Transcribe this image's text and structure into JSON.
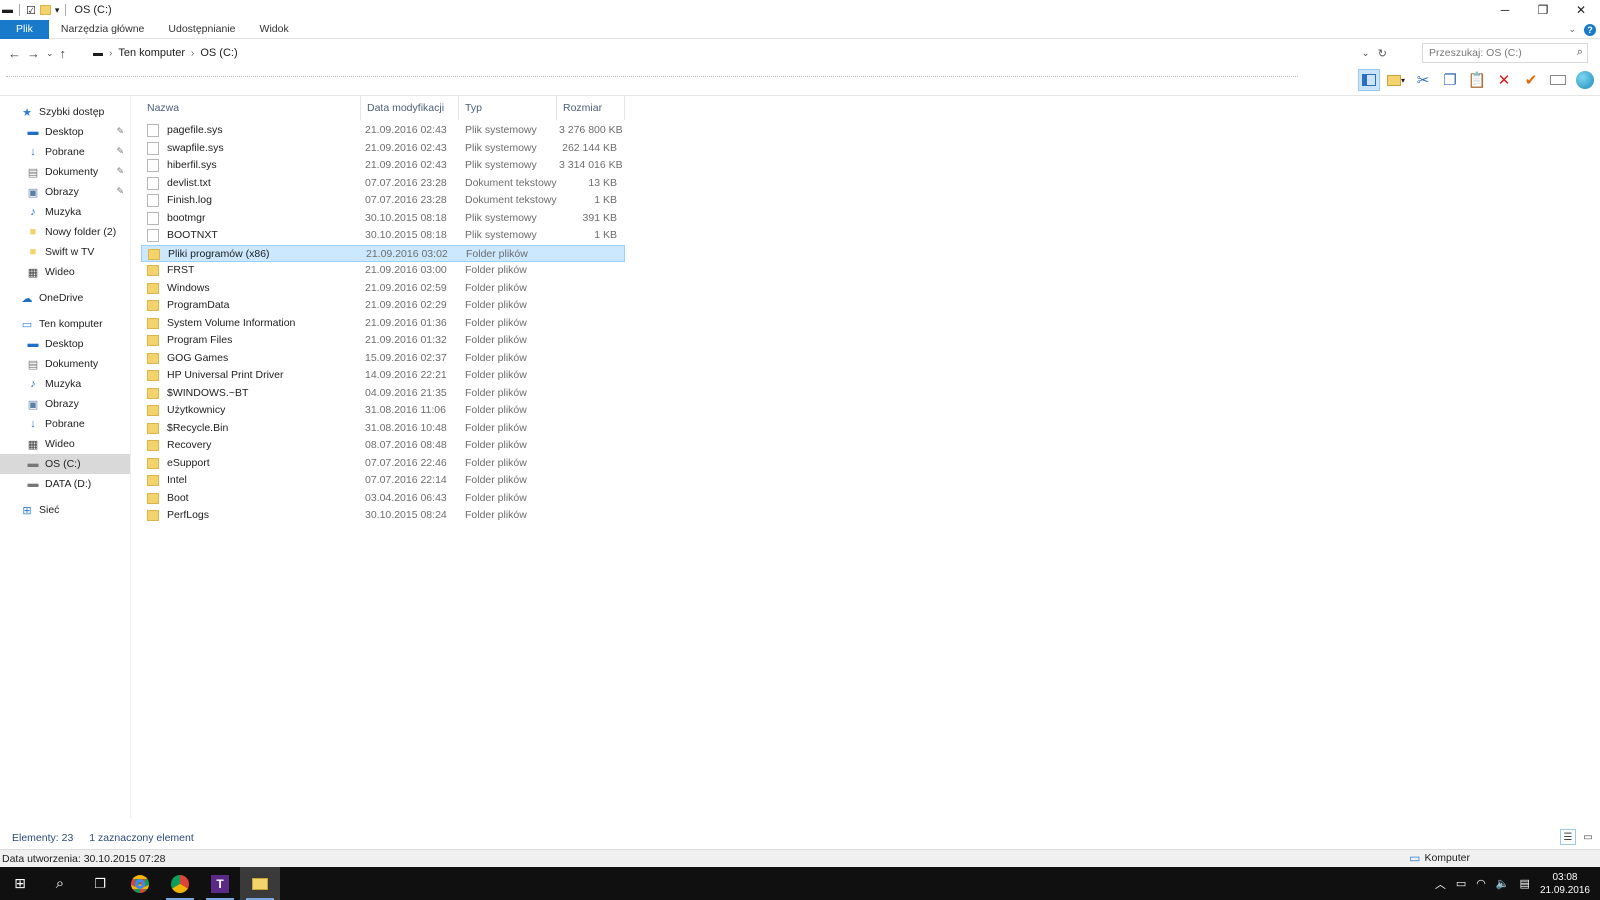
{
  "window": {
    "title": "OS (C:)",
    "controls": {
      "minimize": "─",
      "maximize": "❐",
      "close": "✕"
    }
  },
  "ribbon": {
    "tabs": [
      "Plik",
      "Narzędzia główne",
      "Udostępnianie",
      "Widok"
    ]
  },
  "address": {
    "crumbs": [
      "Ten komputer",
      "OS (C:)"
    ],
    "search_placeholder": "Przeszukaj: OS (C:)"
  },
  "nav": {
    "quick_access": "Szybki dostęp",
    "quick_items": [
      {
        "label": "Desktop",
        "icon": "desktop-icon",
        "pinned": true
      },
      {
        "label": "Pobrane",
        "icon": "download-icon",
        "pinned": true
      },
      {
        "label": "Dokumenty",
        "icon": "documents-icon",
        "pinned": true
      },
      {
        "label": "Obrazy",
        "icon": "pictures-icon",
        "pinned": true
      },
      {
        "label": "Muzyka",
        "icon": "music-icon",
        "pinned": false
      },
      {
        "label": "Nowy folder (2)",
        "icon": "folder-icon",
        "pinned": false
      },
      {
        "label": "Swift w TV",
        "icon": "folder-icon",
        "pinned": false
      },
      {
        "label": "Wideo",
        "icon": "video-icon",
        "pinned": false
      }
    ],
    "onedrive": "OneDrive",
    "this_pc": "Ten komputer",
    "pc_items": [
      {
        "label": "Desktop",
        "icon": "desktop-icon"
      },
      {
        "label": "Dokumenty",
        "icon": "documents-icon"
      },
      {
        "label": "Muzyka",
        "icon": "music-icon"
      },
      {
        "label": "Obrazy",
        "icon": "pictures-icon"
      },
      {
        "label": "Pobrane",
        "icon": "download-icon"
      },
      {
        "label": "Wideo",
        "icon": "video-icon"
      },
      {
        "label": "OS (C:)",
        "icon": "drive-icon",
        "selected": true
      },
      {
        "label": "DATA (D:)",
        "icon": "drive-icon"
      }
    ],
    "network": "Sieć"
  },
  "columns": {
    "name": "Nazwa",
    "date": "Data modyfikacji",
    "type": "Typ",
    "size": "Rozmiar"
  },
  "files": [
    {
      "name": "pagefile.sys",
      "date": "21.09.2016 02:43",
      "type": "Plik systemowy",
      "size": "3 276 800 KB",
      "kind": "file"
    },
    {
      "name": "swapfile.sys",
      "date": "21.09.2016 02:43",
      "type": "Plik systemowy",
      "size": "262 144 KB",
      "kind": "file"
    },
    {
      "name": "hiberfil.sys",
      "date": "21.09.2016 02:43",
      "type": "Plik systemowy",
      "size": "3 314 016 KB",
      "kind": "file"
    },
    {
      "name": "devlist.txt",
      "date": "07.07.2016 23:28",
      "type": "Dokument tekstowy",
      "size": "13 KB",
      "kind": "file"
    },
    {
      "name": "Finish.log",
      "date": "07.07.2016 23:28",
      "type": "Dokument tekstowy",
      "size": "1 KB",
      "kind": "file"
    },
    {
      "name": "bootmgr",
      "date": "30.10.2015 08:18",
      "type": "Plik systemowy",
      "size": "391 KB",
      "kind": "file"
    },
    {
      "name": "BOOTNXT",
      "date": "30.10.2015 08:18",
      "type": "Plik systemowy",
      "size": "1 KB",
      "kind": "file"
    },
    {
      "name": "Pliki programów (x86)",
      "date": "21.09.2016 03:02",
      "type": "Folder plików",
      "size": "",
      "kind": "folder",
      "selected": true
    },
    {
      "name": "FRST",
      "date": "21.09.2016 03:00",
      "type": "Folder plików",
      "size": "",
      "kind": "folder"
    },
    {
      "name": "Windows",
      "date": "21.09.2016 02:59",
      "type": "Folder plików",
      "size": "",
      "kind": "folder"
    },
    {
      "name": "ProgramData",
      "date": "21.09.2016 02:29",
      "type": "Folder plików",
      "size": "",
      "kind": "folder"
    },
    {
      "name": "System Volume Information",
      "date": "21.09.2016 01:36",
      "type": "Folder plików",
      "size": "",
      "kind": "folder"
    },
    {
      "name": "Program Files",
      "date": "21.09.2016 01:32",
      "type": "Folder plików",
      "size": "",
      "kind": "folder"
    },
    {
      "name": "GOG Games",
      "date": "15.09.2016 02:37",
      "type": "Folder plików",
      "size": "",
      "kind": "folder"
    },
    {
      "name": "HP Universal Print Driver",
      "date": "14.09.2016 22:21",
      "type": "Folder plików",
      "size": "",
      "kind": "folder"
    },
    {
      "name": "$WINDOWS.~BT",
      "date": "04.09.2016 21:35",
      "type": "Folder plików",
      "size": "",
      "kind": "folder"
    },
    {
      "name": "Użytkownicy",
      "date": "31.08.2016 11:06",
      "type": "Folder plików",
      "size": "",
      "kind": "folder"
    },
    {
      "name": "$Recycle.Bin",
      "date": "31.08.2016 10:48",
      "type": "Folder plików",
      "size": "",
      "kind": "folder"
    },
    {
      "name": "Recovery",
      "date": "08.07.2016 08:48",
      "type": "Folder plików",
      "size": "",
      "kind": "folder"
    },
    {
      "name": "eSupport",
      "date": "07.07.2016 22:46",
      "type": "Folder plików",
      "size": "",
      "kind": "folder"
    },
    {
      "name": "Intel",
      "date": "07.07.2016 22:14",
      "type": "Folder plików",
      "size": "",
      "kind": "folder"
    },
    {
      "name": "Boot",
      "date": "03.04.2016 06:43",
      "type": "Folder plików",
      "size": "",
      "kind": "folder"
    },
    {
      "name": "PerfLogs",
      "date": "30.10.2015 08:24",
      "type": "Folder plików",
      "size": "",
      "kind": "folder"
    }
  ],
  "status": {
    "count": "Elementy: 23",
    "selected": "1 zaznaczony element",
    "created": "Data utworzenia: 30.10.2015 07:28",
    "zone": "Komputer"
  },
  "taskbar": {
    "time": "03:08",
    "date": "21.09.2016"
  },
  "colors": {
    "accent": "#1979ca",
    "selection": "#cce8ff",
    "folder": "#f3d36b",
    "taskbar": "#101010"
  }
}
